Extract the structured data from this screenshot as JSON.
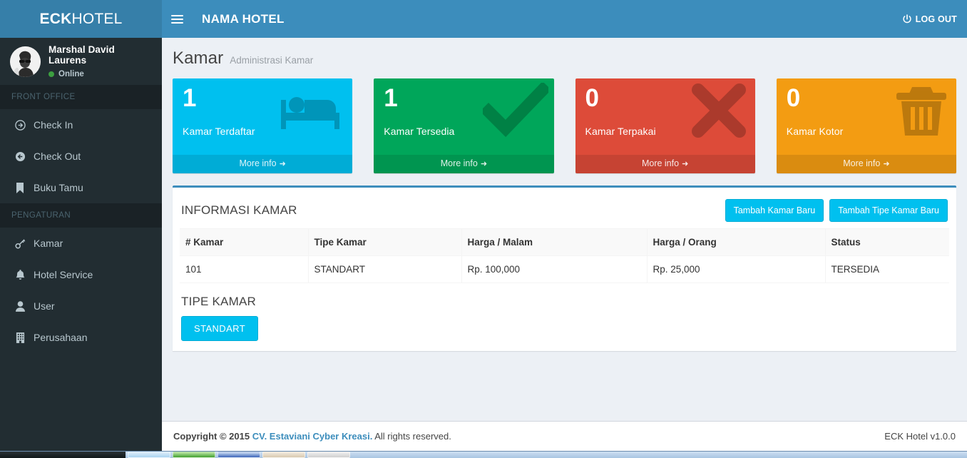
{
  "sidebar": {
    "logo": {
      "bold": "ECK",
      "light": "HOTEL"
    },
    "user": {
      "name": "Marshal David Laurens",
      "status": "Online",
      "avatar_icon": "user-photo-avatar"
    },
    "sections": [
      {
        "header": "FRONT OFFICE",
        "items": [
          {
            "label": "Check In",
            "icon": "arrow-circle-right-icon"
          },
          {
            "label": "Check Out",
            "icon": "arrow-circle-left-icon"
          },
          {
            "label": "Buku Tamu",
            "icon": "bookmark-icon"
          }
        ]
      },
      {
        "header": "PENGATURAN",
        "items": [
          {
            "label": "Kamar",
            "icon": "key-icon"
          },
          {
            "label": "Hotel Service",
            "icon": "bell-icon"
          },
          {
            "label": "User",
            "icon": "user-icon"
          },
          {
            "label": "Perusahaan",
            "icon": "building-icon"
          }
        ]
      }
    ]
  },
  "header": {
    "brand": "NAMA HOTEL",
    "menu_toggle_icon": "hamburger-icon",
    "logout_label": "LOG OUT",
    "logout_icon": "power-off-icon"
  },
  "page": {
    "title": "Kamar",
    "subtitle": "Administrasi Kamar"
  },
  "info_boxes": [
    {
      "number": "1",
      "label": "Kamar Terdaftar",
      "more": "More info",
      "color": "#00c0ef",
      "icon": "bed-icon"
    },
    {
      "number": "1",
      "label": "Kamar Tersedia",
      "more": "More info",
      "color": "#00a65a",
      "icon": "check-icon"
    },
    {
      "number": "0",
      "label": "Kamar Terpakai",
      "more": "More info",
      "color": "#dd4b39",
      "icon": "times-icon"
    },
    {
      "number": "0",
      "label": "Kamar Kotor",
      "more": "More info",
      "color": "#f39c12",
      "icon": "trash-icon"
    }
  ],
  "panel": {
    "title": "INFORMASI KAMAR",
    "buttons": [
      {
        "label": "Tambah Kamar Baru"
      },
      {
        "label": "Tambah Tipe Kamar Baru"
      }
    ],
    "table": {
      "columns": [
        "# Kamar",
        "Tipe Kamar",
        "Harga / Malam",
        "Harga / Orang",
        "Status"
      ],
      "rows": [
        [
          "101",
          "STANDART",
          "Rp. 100,000",
          "Rp. 25,000",
          "TERSEDIA"
        ]
      ]
    },
    "tipe_kamar": {
      "title": "TIPE KAMAR",
      "items": [
        "STANDART"
      ]
    }
  },
  "footer": {
    "copyright_prefix": "Copyright © 2015 ",
    "company": "CV. Estaviani Cyber Kreasi.",
    "copyright_suffix": " All rights reserved.",
    "version": "ECK Hotel v1.0.0"
  },
  "accent": {
    "primary": "#3c8dbc",
    "info": "#00c0ef",
    "sidebar": "#222d32"
  }
}
